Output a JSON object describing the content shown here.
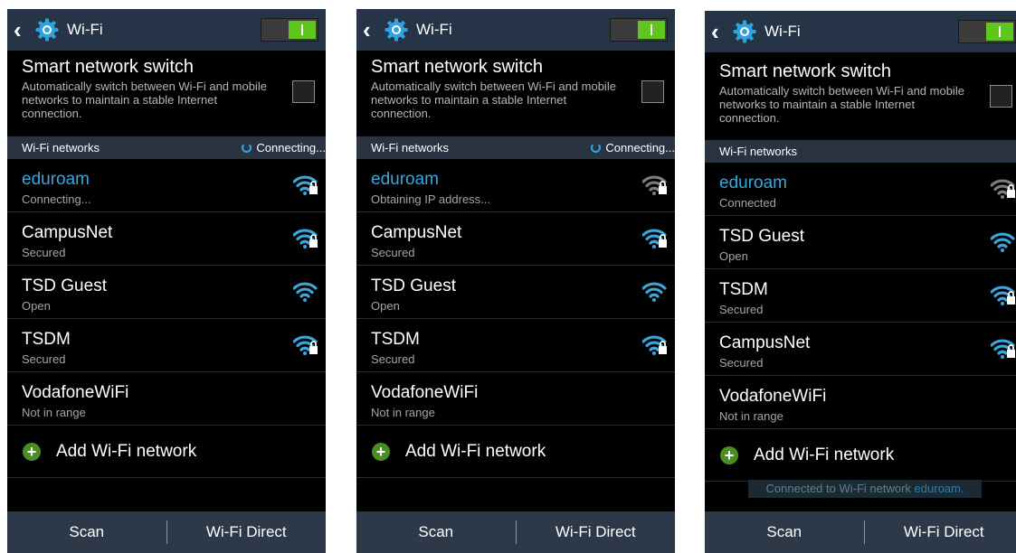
{
  "colors": {
    "accent": "#3ba6d9",
    "toggle_on": "#5fc61e",
    "actionbar": "#263447",
    "wifi_dim": "#7d7d7d"
  },
  "screens": [
    {
      "header": {
        "back_icon": "chevron-left-icon",
        "settings_icon": "gear-icon",
        "title": "Wi-Fi",
        "toggle_state": "on"
      },
      "smart_switch": {
        "title": "Smart network switch",
        "description": "Automatically switch between Wi-Fi and mobile networks to maintain a stable Internet connection.",
        "checked": false
      },
      "section": {
        "label": "Wi-Fi networks",
        "status": "Connecting..."
      },
      "networks": [
        {
          "name": "eduroam",
          "status": "Connecting...",
          "active": true,
          "signal": "wifi-locked-icon",
          "signal_color": "#3ba6d9"
        },
        {
          "name": "CampusNet",
          "status": "Secured",
          "active": false,
          "signal": "wifi-locked-icon",
          "signal_color": "#3ba6d9"
        },
        {
          "name": "TSD Guest",
          "status": "Open",
          "active": false,
          "signal": "wifi-icon",
          "signal_color": "#3ba6d9"
        },
        {
          "name": "TSDM",
          "status": "Secured",
          "active": false,
          "signal": "wifi-locked-icon",
          "signal_color": "#3ba6d9"
        },
        {
          "name": "VodafoneWiFi",
          "status": "Not in range",
          "active": false,
          "signal": "",
          "signal_color": ""
        }
      ],
      "add_network": {
        "icon": "plus-icon",
        "label": "Add Wi-Fi network"
      },
      "toast": null,
      "bottom": {
        "scan": "Scan",
        "direct": "Wi-Fi Direct"
      }
    },
    {
      "header": {
        "back_icon": "chevron-left-icon",
        "settings_icon": "gear-icon",
        "title": "Wi-Fi",
        "toggle_state": "on"
      },
      "smart_switch": {
        "title": "Smart network switch",
        "description": "Automatically switch between Wi-Fi and mobile networks to maintain a stable Internet connection.",
        "checked": false
      },
      "section": {
        "label": "Wi-Fi networks",
        "status": "Connecting..."
      },
      "networks": [
        {
          "name": "eduroam",
          "status": "Obtaining IP address...",
          "active": true,
          "signal": "wifi-locked-icon",
          "signal_color": "#7d7d7d"
        },
        {
          "name": "CampusNet",
          "status": "Secured",
          "active": false,
          "signal": "wifi-locked-icon",
          "signal_color": "#3ba6d9"
        },
        {
          "name": "TSD Guest",
          "status": "Open",
          "active": false,
          "signal": "wifi-icon",
          "signal_color": "#3ba6d9"
        },
        {
          "name": "TSDM",
          "status": "Secured",
          "active": false,
          "signal": "wifi-locked-icon",
          "signal_color": "#3ba6d9"
        },
        {
          "name": "VodafoneWiFi",
          "status": "Not in range",
          "active": false,
          "signal": "",
          "signal_color": ""
        }
      ],
      "add_network": {
        "icon": "plus-icon",
        "label": "Add Wi-Fi network"
      },
      "toast": null,
      "bottom": {
        "scan": "Scan",
        "direct": "Wi-Fi Direct"
      }
    },
    {
      "header": {
        "back_icon": "chevron-left-icon",
        "settings_icon": "gear-icon",
        "title": "Wi-Fi",
        "toggle_state": "on"
      },
      "smart_switch": {
        "title": "Smart network switch",
        "description": "Automatically switch between Wi-Fi and mobile networks to maintain a stable Internet connection.",
        "checked": false
      },
      "section": {
        "label": "Wi-Fi networks",
        "status": ""
      },
      "networks": [
        {
          "name": "eduroam",
          "status": "Connected",
          "active": true,
          "signal": "wifi-locked-icon",
          "signal_color": "#7d7d7d"
        },
        {
          "name": "TSD Guest",
          "status": "Open",
          "active": false,
          "signal": "wifi-icon",
          "signal_color": "#3ba6d9"
        },
        {
          "name": "TSDM",
          "status": "Secured",
          "active": false,
          "signal": "wifi-locked-icon",
          "signal_color": "#3ba6d9"
        },
        {
          "name": "CampusNet",
          "status": "Secured",
          "active": false,
          "signal": "wifi-locked-icon",
          "signal_color": "#3ba6d9"
        },
        {
          "name": "VodafoneWiFi",
          "status": "Not in range",
          "active": false,
          "signal": "",
          "signal_color": ""
        }
      ],
      "add_network": {
        "icon": "plus-icon",
        "label": "Add Wi-Fi network"
      },
      "toast": {
        "text": "Connected to Wi-Fi network ",
        "network": "eduroam."
      },
      "bottom": {
        "scan": "Scan",
        "direct": "Wi-Fi Direct"
      }
    }
  ]
}
